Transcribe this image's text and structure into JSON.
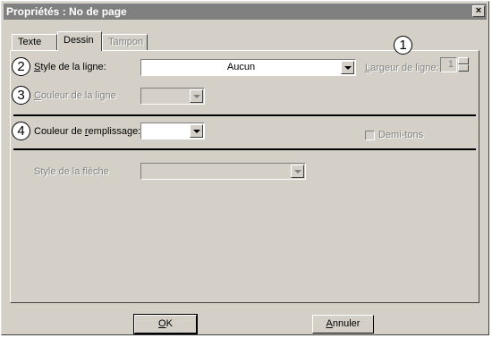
{
  "window": {
    "title": "Propriétés : No de page",
    "close_label": "×"
  },
  "tabs": [
    {
      "label": "Texte",
      "state": "normal"
    },
    {
      "label": "Dessin",
      "state": "active"
    },
    {
      "label": "Tampon",
      "state": "disabled"
    }
  ],
  "callouts": [
    "1",
    "2",
    "3",
    "4"
  ],
  "line_style": {
    "label_mnemonic": "S",
    "label_rest": "tyle de la ligne:",
    "value": "Aucun"
  },
  "line_width": {
    "label_mnemonic": "L",
    "label_rest": "argeur de ligne:",
    "value": "1"
  },
  "line_color": {
    "label_mnemonic": "C",
    "label_rest": "ouleur de la ligne"
  },
  "fill_color": {
    "label_pre": "Couleur de ",
    "label_mnemonic": "r",
    "label_rest": "emplissage:"
  },
  "halftones": {
    "label": "Demi-tons",
    "checked": false
  },
  "arrow_style": {
    "label": "Style de la flèche"
  },
  "buttons": {
    "ok_mnemonic": "O",
    "ok_rest": "K",
    "cancel_mnemonic": "A",
    "cancel_rest": "nnuler"
  }
}
